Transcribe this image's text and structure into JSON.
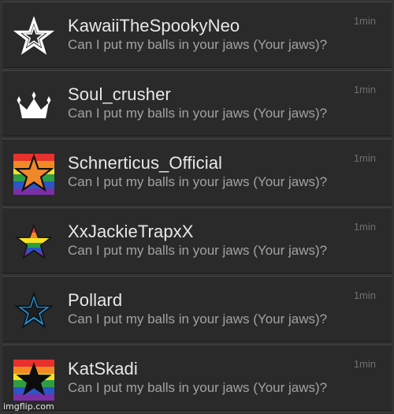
{
  "messages": [
    {
      "username": "KawaiiTheSpookyNeo",
      "message": "Can I put my balls in your jaws (Your jaws)?",
      "time": "1min",
      "icon": "outline-star-icon"
    },
    {
      "username": "Soul_crusher",
      "message": "Can I put my balls in your jaws (Your jaws)?",
      "time": "1min",
      "icon": "crown-icon"
    },
    {
      "username": "Schnerticus_Official",
      "message": "Can I put my balls in your jaws (Your jaws)?",
      "time": "1min",
      "icon": "rainbow-orange-star-icon"
    },
    {
      "username": "XxJackieTrapxX",
      "message": "Can I put my balls in your jaws (Your jaws)?",
      "time": "1min",
      "icon": "rainbow-star-icon"
    },
    {
      "username": "Pollard",
      "message": "Can I put my balls in your jaws (Your jaws)?",
      "time": "1min",
      "icon": "blue-star-icon"
    },
    {
      "username": "KatSkadi",
      "message": "Can I put my balls in your jaws (Your jaws)?",
      "time": "1min",
      "icon": "rainbow-black-star-icon"
    }
  ],
  "watermark": "imgflip.com",
  "colors": {
    "row_background": "#2a2a2a",
    "username": "#e8e8e8",
    "message": "#a2a2a2",
    "time": "#6f6f6f"
  }
}
